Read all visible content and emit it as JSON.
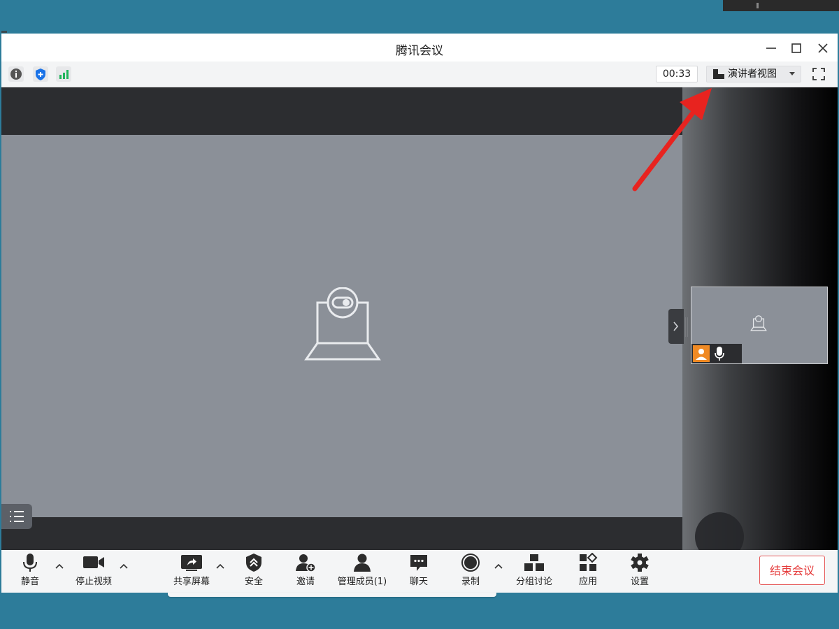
{
  "window": {
    "title": "腾讯会议"
  },
  "toolbar": {
    "icons": [
      "info-icon",
      "shield-icon",
      "signal-icon"
    ],
    "timer": "00:33",
    "view_label": "演讲者视图"
  },
  "bottom_bar": {
    "mute": "静音",
    "stop_video": "停止视频",
    "share_screen": "共享屏幕",
    "security": "安全",
    "invite": "邀请",
    "manage_members": "管理成员(1)",
    "chat": "聊天",
    "record": "录制",
    "breakout": "分组讨论",
    "apps": "应用",
    "settings": "设置",
    "end_meeting": "结束会议"
  },
  "colors": {
    "accent_blue": "#1a73e8",
    "signal_green": "#1fb55a",
    "end_red": "#e53a3a",
    "avatar_orange": "#f08a24",
    "annotation_arrow": "#e8231f"
  }
}
